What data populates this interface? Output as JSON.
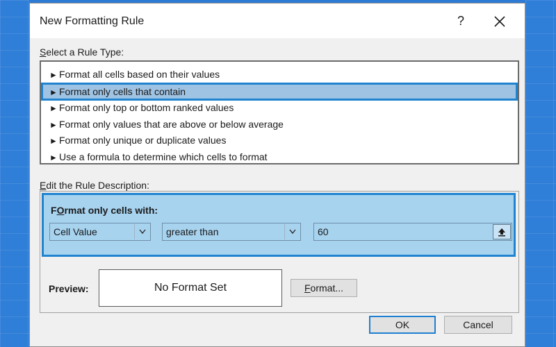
{
  "dialog": {
    "title": "New Formatting Rule",
    "help_label": "?",
    "close_icon": "close-icon"
  },
  "rule_type": {
    "label_accel": "S",
    "label_rest": "elect a Rule Type:",
    "items": [
      {
        "label": "Format all cells based on their values",
        "selected": false
      },
      {
        "label": "Format only cells that contain",
        "selected": true
      },
      {
        "label": "Format only top or bottom ranked values",
        "selected": false
      },
      {
        "label": "Format only values that are above or below average",
        "selected": false
      },
      {
        "label": "Format only unique or duplicate values",
        "selected": false
      },
      {
        "label": "Use a formula to determine which cells to format",
        "selected": false
      }
    ],
    "item_arrow": "►"
  },
  "rule_description": {
    "label_accel": "E",
    "label_rest": "dit the Rule Description:",
    "format_with_accel": "O",
    "format_with_rest_before": "F",
    "format_with_rest_after": "rmat only cells with:",
    "condition_field": "Cell Value",
    "operator": "greater than",
    "value": "60",
    "collapse_icon": "collapse-dialog-icon",
    "dropdown_icon": "chevron-down-icon"
  },
  "preview": {
    "label": "Preview:",
    "text": "No Format Set",
    "format_button_accel": "F",
    "format_button_rest": "ormat..."
  },
  "footer": {
    "ok_label": "OK",
    "cancel_label": "Cancel"
  },
  "colors": {
    "background": "#2e7bd6",
    "selection": "#9fc3e3",
    "highlight_border": "#1f83d0",
    "panel_fill": "#a7d3ef"
  }
}
